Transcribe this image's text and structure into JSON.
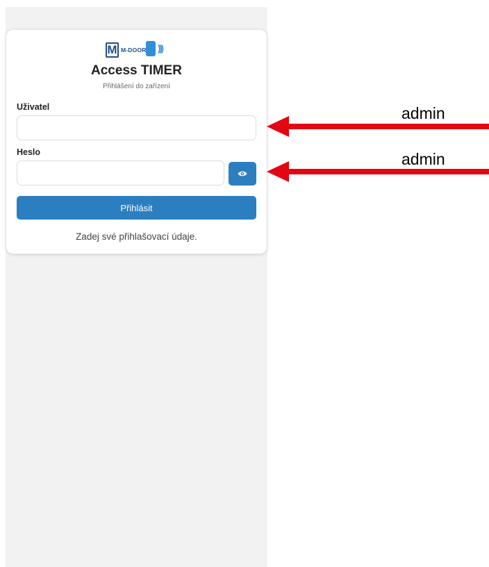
{
  "brand": {
    "logo_text": "M-DOOR",
    "logo_letter": "M",
    "title": "Access TIMER",
    "subtitle": "Přihlášení do zařízení"
  },
  "form": {
    "username_label": "Uživatel",
    "username_value": "",
    "password_label": "Heslo",
    "password_value": "",
    "submit_label": "Přihlásit",
    "hint": "Zadej své přihlašovací údaje."
  },
  "annotations": [
    {
      "text": "admin"
    },
    {
      "text": "admin"
    }
  ],
  "colors": {
    "primary": "#2b7fc0",
    "arrow": "#e30613",
    "logo_dark": "#1f4f8a",
    "logo_light": "#2f8fd9"
  },
  "icons": {
    "show_password": "eye-icon",
    "annotation_arrow": "arrow-left-icon"
  }
}
